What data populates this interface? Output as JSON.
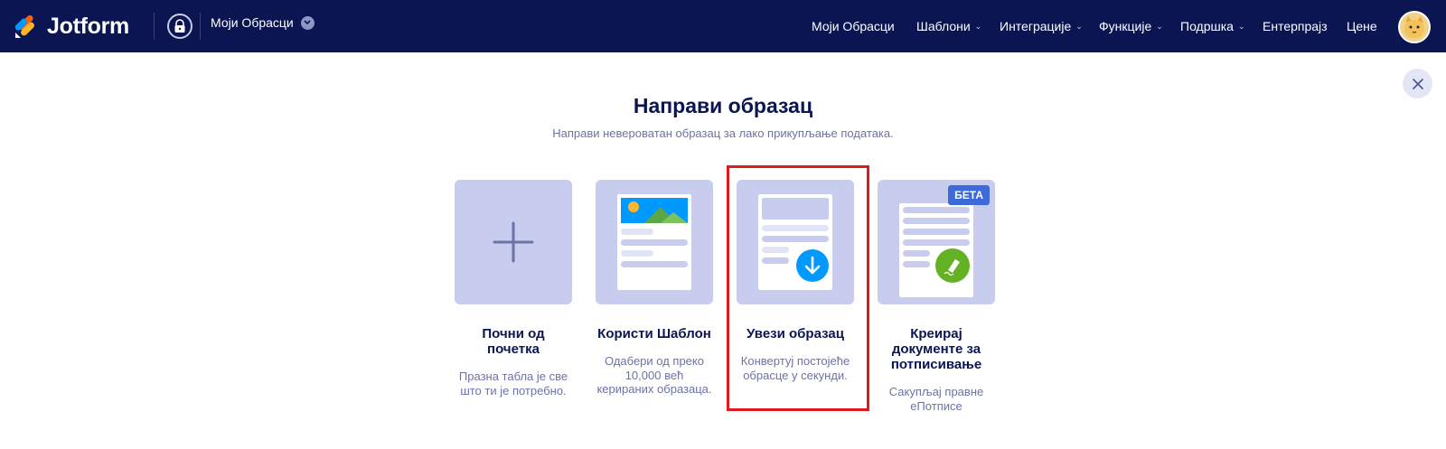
{
  "header": {
    "brand": "Jotform",
    "myforms_button": "Моји Обрасци",
    "nav": [
      {
        "label": "Моји Обрасци",
        "has_caret": false
      },
      {
        "label": "Шаблони",
        "has_caret": true
      },
      {
        "label": "Интеграције",
        "has_caret": true
      },
      {
        "label": "Функције",
        "has_caret": true
      },
      {
        "label": "Подршка",
        "has_caret": true
      },
      {
        "label": "Ентерпрајз",
        "has_caret": false
      },
      {
        "label": "Цене",
        "has_caret": false
      }
    ]
  },
  "main": {
    "title": "Направи образац",
    "subtitle": "Направи невероватан образац за лако прикупљање података.",
    "cards": [
      {
        "title": "Почни од почетка",
        "desc": "Празна табла је све што ти је потребно."
      },
      {
        "title": "Користи Шаблон",
        "desc": "Одабери од преко 10,000 већ керираних образаца."
      },
      {
        "title": "Увези образац",
        "desc": "Конвертуј постојеће обрасце у секунди."
      },
      {
        "title": "Креирај документе за потписивање",
        "desc": "Сакупљај правне еПотписе",
        "badge": "БЕТА"
      }
    ]
  },
  "colors": {
    "topbar_bg": "#0a1551",
    "card_bg": "#c8cdf0",
    "highlight_border": "#e0191d",
    "accent_blue": "#0099ff",
    "accent_green": "#64b125"
  }
}
